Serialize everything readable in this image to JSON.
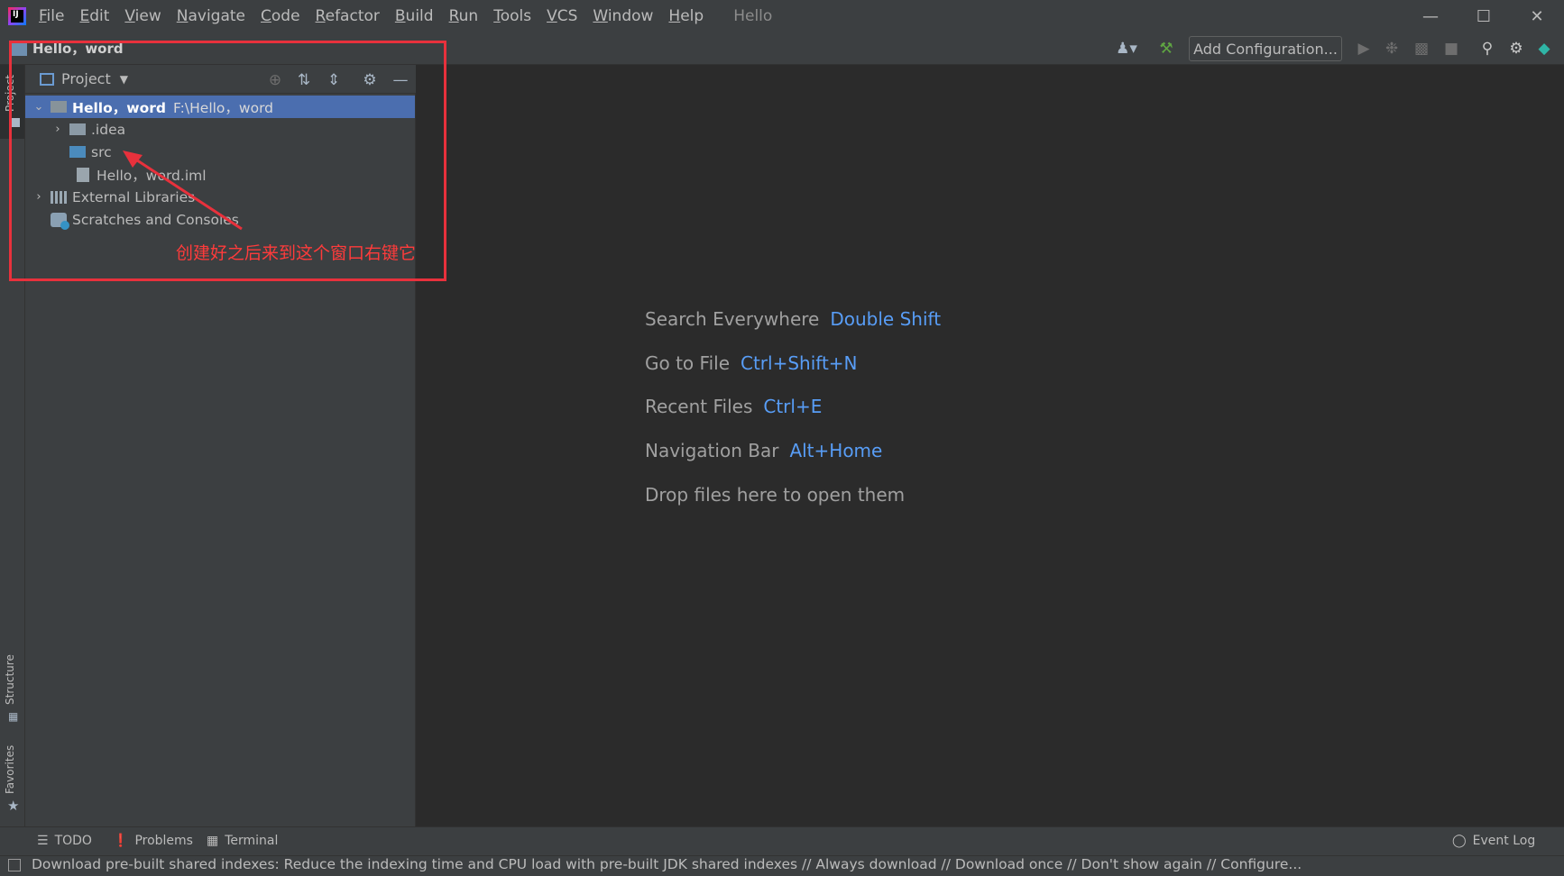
{
  "titlebar": {
    "menu": [
      {
        "label": "File",
        "mnemonic": "F",
        "rest": "ile"
      },
      {
        "label": "Edit",
        "mnemonic": "E",
        "rest": "dit"
      },
      {
        "label": "View",
        "mnemonic": "V",
        "rest": "iew"
      },
      {
        "label": "Navigate",
        "mnemonic": "N",
        "rest": "avigate"
      },
      {
        "label": "Code",
        "mnemonic": "C",
        "rest": "ode"
      },
      {
        "label": "Refactor",
        "mnemonic": "R",
        "rest": "efactor"
      },
      {
        "label": "Build",
        "mnemonic": "B",
        "rest": "uild"
      },
      {
        "label": "Run",
        "mnemonic": "R",
        "rest": "un"
      },
      {
        "label": "Tools",
        "mnemonic": "T",
        "rest": "ools"
      },
      {
        "label": "VCS",
        "mnemonic": "V",
        "rest": "CS"
      },
      {
        "label": "Window",
        "mnemonic": "W",
        "rest": "indow"
      },
      {
        "label": "Help",
        "mnemonic": "H",
        "rest": "elp"
      }
    ],
    "project_name": "Hello",
    "logo_text": "IJ"
  },
  "navbar": {
    "breadcrumb": "Hello，word",
    "add_configuration": "Add Configuration..."
  },
  "left_stripe": {
    "project_tab": "Project",
    "structure_tab": "Structure",
    "favorites_tab": "Favorites"
  },
  "project_panel": {
    "title": "Project",
    "tree": {
      "root_name": "Hello，word",
      "root_path": "F:\\Hello，word",
      "idea": ".idea",
      "src": "src",
      "iml": "Hello，word.iml",
      "external_libraries": "External Libraries",
      "scratches": "Scratches and Consoles"
    }
  },
  "annotation": {
    "note": "创建好之后来到这个窗口右键它"
  },
  "editor_hints": [
    {
      "label": "Search Everywhere",
      "key": "Double Shift"
    },
    {
      "label": "Go to File",
      "key": "Ctrl+Shift+N"
    },
    {
      "label": "Recent Files",
      "key": "Ctrl+E"
    },
    {
      "label": "Navigation Bar",
      "key": "Alt+Home"
    },
    {
      "label": "Drop files here to open them",
      "key": ""
    }
  ],
  "bottom_tabs": {
    "todo": "TODO",
    "problems": "Problems",
    "terminal": "Terminal",
    "event_log": "Event Log"
  },
  "status": {
    "message": "Download pre-built shared indexes: Reduce the indexing time and CPU load with pre-built JDK shared indexes // Always download // Download once // Don't show again // Configure..."
  },
  "colors": {
    "accent_key": "#589df6",
    "selection": "#4b6eaf",
    "annotation_red": "#e8313c"
  }
}
